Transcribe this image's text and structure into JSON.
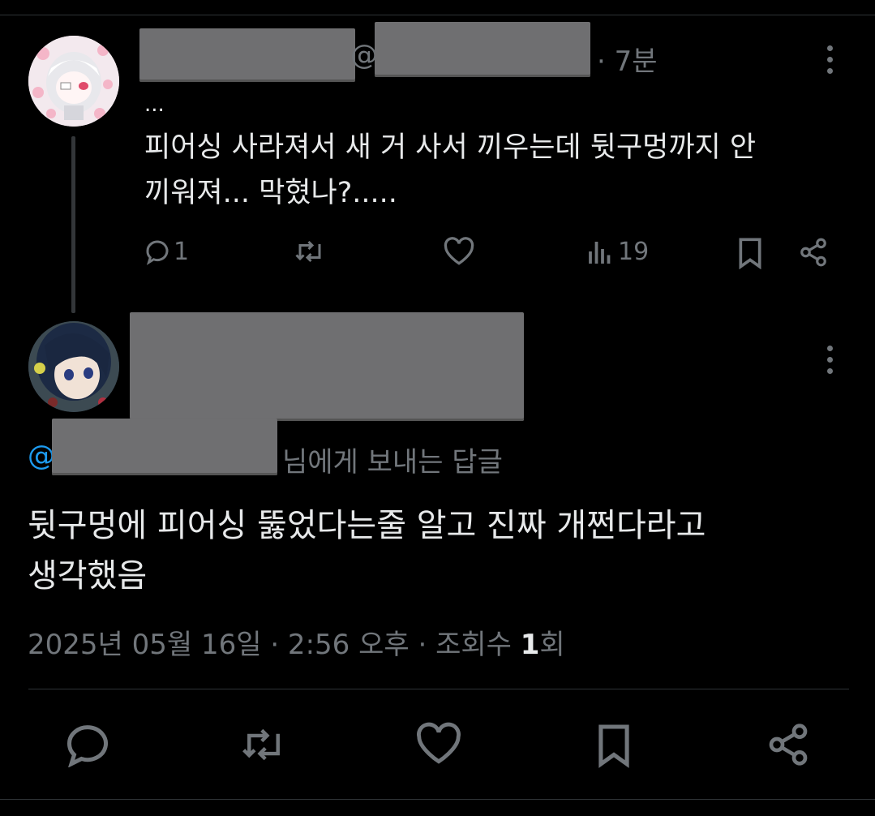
{
  "parent": {
    "handle_at": "@",
    "time": "· 7분",
    "ellipsis": "...",
    "text_line1": "피어싱 사라져서 새 거 사서 끼우는데 뒷구멍까지 안",
    "text_line2": "끼워져... 막혔나?.....",
    "replies": "1",
    "views": "19"
  },
  "reply": {
    "reply_to_at": "@",
    "reply_to_suffix": "님에게 보내는 답글",
    "text_line1": "뒷구멍에 피어싱 뚫었다는줄 알고 진짜 개쩐다라고",
    "text_line2": "생각했음",
    "timestamp": "2025년 05월 16일 · 2:56 오후 · 조회수",
    "view_count": "1",
    "view_unit": "회"
  },
  "icons": {
    "reply": "reply-icon",
    "retweet": "retweet-icon",
    "like": "heart-icon",
    "views": "views-icon",
    "bookmark": "bookmark-icon",
    "share": "share-icon",
    "more": "more-icon"
  },
  "colors": {
    "background": "#000000",
    "text": "#e7e9ea",
    "muted": "#71767b",
    "link": "#1d9bf0"
  }
}
